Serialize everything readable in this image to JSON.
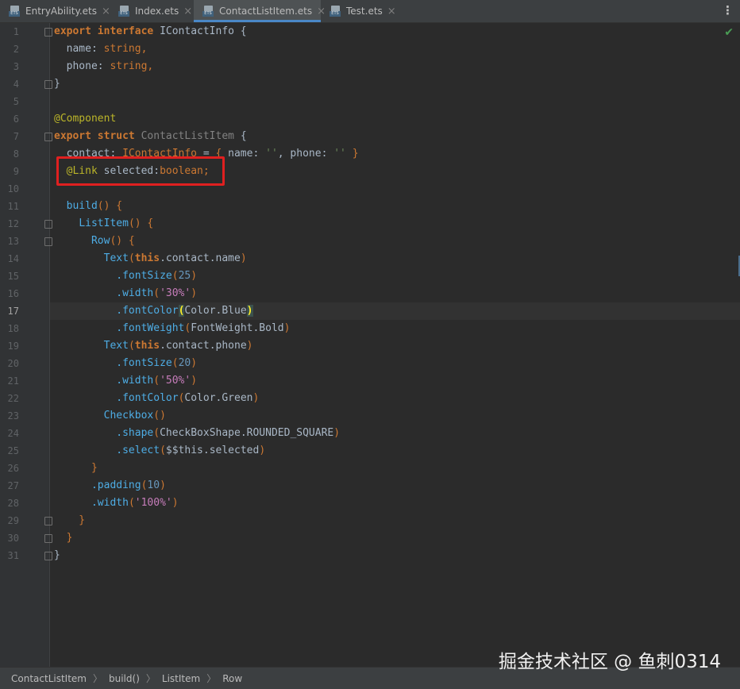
{
  "tabs": [
    {
      "label": "EntryAbility.ets",
      "icon": "ets-file-icon",
      "badge": "ETS",
      "close": "×",
      "active": false
    },
    {
      "label": "Index.ets",
      "icon": "ets-file-icon",
      "badge": "ETS",
      "close": "×",
      "active": false
    },
    {
      "label": "ContactListItem.ets",
      "icon": "ets-file-icon",
      "badge": "ETS",
      "close": "×",
      "active": true
    },
    {
      "label": "Test.ets",
      "icon": "ets-file-icon",
      "badge": "ETS",
      "close": "×",
      "active": false
    }
  ],
  "menu": "⋮",
  "inspection_icon": "✔",
  "current_line": 17,
  "highlighted_line": 9,
  "lines": [
    "1",
    "2",
    "3",
    "4",
    "5",
    "6",
    "7",
    "8",
    "9",
    "10",
    "11",
    "12",
    "13",
    "14",
    "15",
    "16",
    "17",
    "18",
    "19",
    "20",
    "21",
    "22",
    "23",
    "24",
    "25",
    "26",
    "27",
    "28",
    "29",
    "30",
    "31"
  ],
  "code": {
    "l1": {
      "t0": "export",
      "t1": " interface ",
      "t2": "IContactInfo",
      "t3": " {"
    },
    "l2": {
      "t0": "  name: ",
      "t1": "string",
      "t2": ","
    },
    "l3": {
      "t0": "  phone: ",
      "t1": "string",
      "t2": ","
    },
    "l4": {
      "t0": "}"
    },
    "l6": {
      "t0": "@Component"
    },
    "l7": {
      "t0": "export",
      "t1": " struct ",
      "t2": "ContactListItem",
      "t3": " {"
    },
    "l8": {
      "t0": "  contact: ",
      "t1": "IContactInfo",
      "t2": " = ",
      "t3": "{",
      "t4": " name: ",
      "t5": "''",
      "t6": ", phone: ",
      "t7": "''",
      "t8": " }"
    },
    "l9": {
      "t0": "  ",
      "t1": "@Link",
      "t2": " selected:",
      "t3": "boolean",
      "t4": ";"
    },
    "l11": {
      "t0": "  ",
      "t1": "build",
      "t2": "()",
      "t3": " {"
    },
    "l12": {
      "t0": "    ",
      "t1": "ListItem",
      "t2": "()",
      "t3": " {"
    },
    "l13": {
      "t0": "      ",
      "t1": "Row",
      "t2": "()",
      "t3": " {"
    },
    "l14": {
      "t0": "        ",
      "t1": "Text",
      "t2": "(",
      "t3": "this",
      "t4": ".contact.name",
      "t5": ")"
    },
    "l15": {
      "t0": "          ",
      "t1": ".fontSize",
      "t2": "(",
      "t3": "25",
      "t4": ")"
    },
    "l16": {
      "t0": "          ",
      "t1": ".width",
      "t2": "(",
      "t3": "'30%'",
      "t4": ")"
    },
    "l17": {
      "t0": "          ",
      "t1": ".fontColor",
      "t2": "(",
      "t3": "Color.Blue",
      "t4": ")"
    },
    "l18": {
      "t0": "          ",
      "t1": ".fontWeight",
      "t2": "(",
      "t3": "FontWeight.Bold",
      "t4": ")"
    },
    "l19": {
      "t0": "        ",
      "t1": "Text",
      "t2": "(",
      "t3": "this",
      "t4": ".contact.phone",
      "t5": ")"
    },
    "l20": {
      "t0": "          ",
      "t1": ".fontSize",
      "t2": "(",
      "t3": "20",
      "t4": ")"
    },
    "l21": {
      "t0": "          ",
      "t1": ".width",
      "t2": "(",
      "t3": "'50%'",
      "t4": ")"
    },
    "l22": {
      "t0": "          ",
      "t1": ".fontColor",
      "t2": "(",
      "t3": "Color.Green",
      "t4": ")"
    },
    "l23": {
      "t0": "        ",
      "t1": "Checkbox",
      "t2": "()"
    },
    "l24": {
      "t0": "          ",
      "t1": ".shape",
      "t2": "(",
      "t3": "CheckBoxShape.ROUNDED_SQUARE",
      "t4": ")"
    },
    "l25": {
      "t0": "          ",
      "t1": ".select",
      "t2": "(",
      "t3": "$$this.selected",
      "t4": ")"
    },
    "l26": {
      "t0": "      }"
    },
    "l27": {
      "t0": "      ",
      "t1": ".padding",
      "t2": "(",
      "t3": "10",
      "t4": ")"
    },
    "l28": {
      "t0": "      ",
      "t1": ".width",
      "t2": "(",
      "t3": "'100%'",
      "t4": ")"
    },
    "l29": {
      "t0": "    }"
    },
    "l30": {
      "t0": "  }"
    },
    "l31": {
      "t0": "}"
    }
  },
  "breadcrumb": [
    "ContactListItem",
    "build()",
    "ListItem",
    "Row"
  ],
  "breadcrumb_separator": "〉",
  "watermark": "掘金技术社区 @ 鱼刺0314"
}
